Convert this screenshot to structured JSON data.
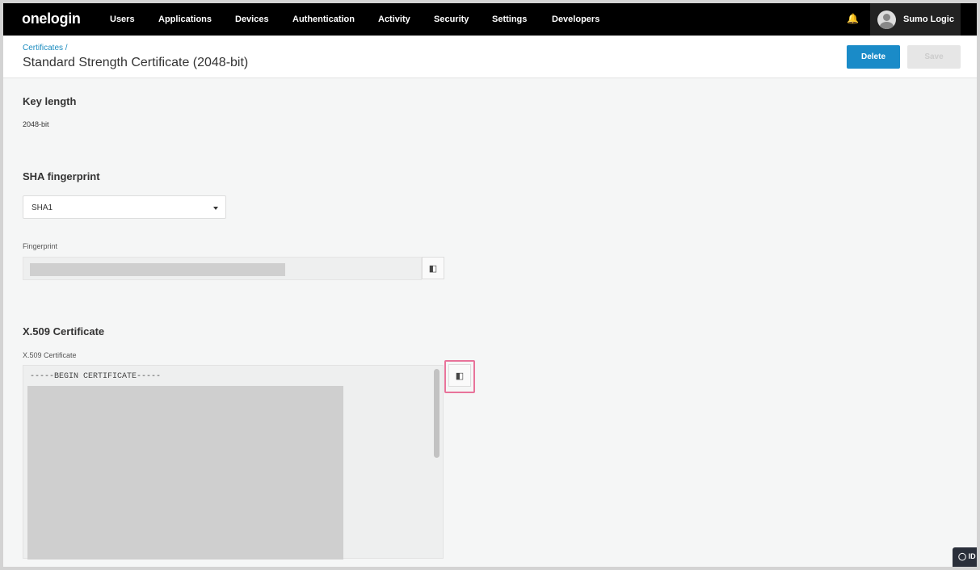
{
  "nav": {
    "logo": "onelogin",
    "items": [
      "Users",
      "Applications",
      "Devices",
      "Authentication",
      "Activity",
      "Security",
      "Settings",
      "Developers"
    ],
    "user": "Sumo Logic"
  },
  "header": {
    "breadcrumb": "Certificates /",
    "title": "Standard Strength Certificate (2048-bit)",
    "delete_label": "Delete",
    "save_label": "Save"
  },
  "key_length": {
    "heading": "Key length",
    "value": "2048-bit"
  },
  "sha": {
    "heading": "SHA fingerprint",
    "selected": "SHA1",
    "fingerprint_label": "Fingerprint"
  },
  "x509": {
    "heading": "X.509 Certificate",
    "label": "X.509 Certificate",
    "first_line": "-----BEGIN CERTIFICATE-----"
  },
  "corner_badge": "ID",
  "colors": {
    "accent": "#1a8bc8",
    "highlight": "#e8739a"
  }
}
